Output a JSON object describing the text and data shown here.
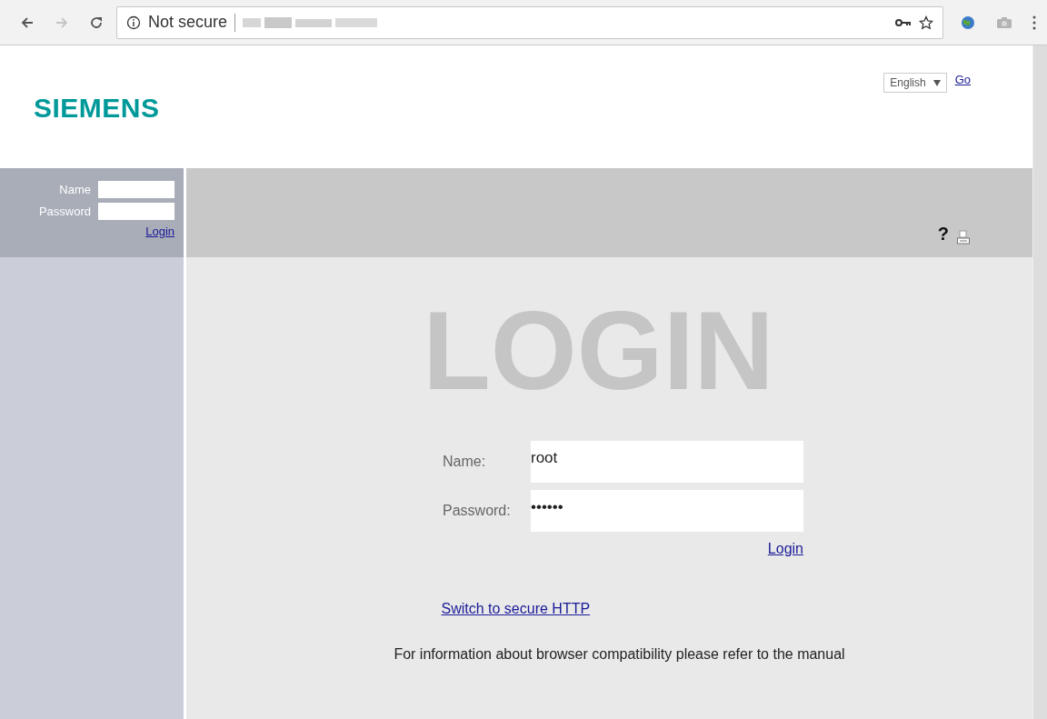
{
  "browser": {
    "security": "Not secure"
  },
  "header": {
    "logo": "SIEMENS",
    "language": "English",
    "go_link": "Go"
  },
  "sidebar_login": {
    "name_label": "Name",
    "password_label": "Password",
    "login_link": "Login"
  },
  "toolbar": {
    "help": "?"
  },
  "login": {
    "title": "LOGIN",
    "name_label": "Name:",
    "name_value": "root",
    "password_label": "Password:",
    "password_value": "••••••",
    "login_link": "Login",
    "secure_link": "Switch to secure HTTP",
    "info": "For information about browser compatibility please refer to the manual"
  }
}
